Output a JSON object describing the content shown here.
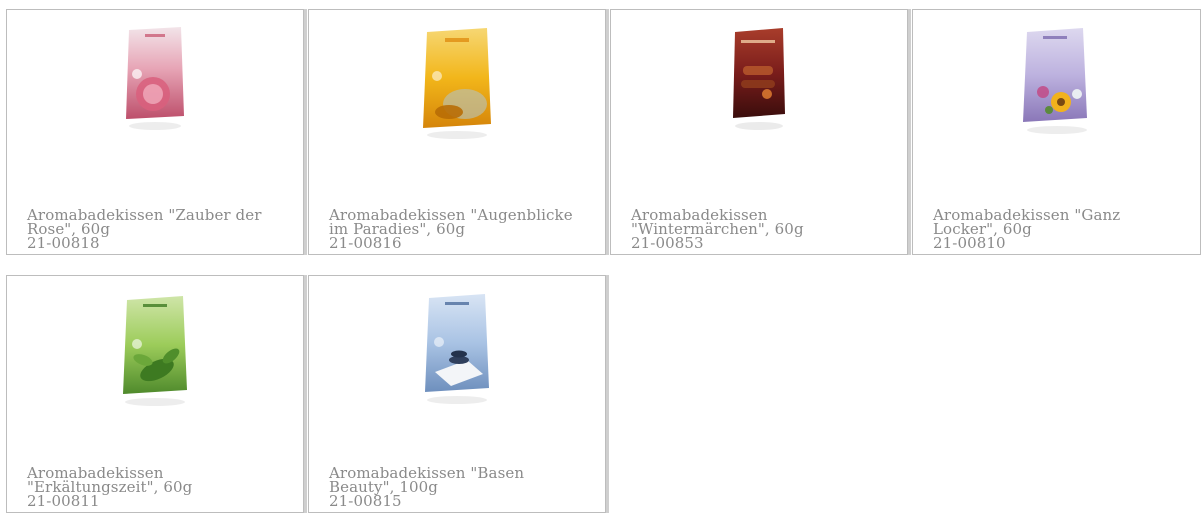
{
  "products": [
    {
      "title": "Aromabadekissen \"Zauber der Rose\", 60g",
      "sku": "21-00818",
      "image_icon": "rose-bath-sachet-icon",
      "colors": {
        "top": "#f2e4e9",
        "mid": "#e7a5b6",
        "bottom": "#bd4f6b"
      }
    },
    {
      "title": "Aromabadekissen \"Augenblicke im Paradies\", 60g",
      "sku": "21-00816",
      "image_icon": "paradise-bath-sachet-icon",
      "colors": {
        "top": "#f6d773",
        "mid": "#f2b61a",
        "bottom": "#d5850a"
      }
    },
    {
      "title": "Aromabadekissen \"Wintermärchen\", 60g",
      "sku": "21-00853",
      "image_icon": "winter-tale-bath-sachet-icon",
      "colors": {
        "top": "#a93d2b",
        "mid": "#7a1d1b",
        "bottom": "#3a0d0c"
      }
    },
    {
      "title": "Aromabadekissen \"Ganz Locker\", 60g",
      "sku": "21-00810",
      "image_icon": "relax-bath-sachet-icon",
      "colors": {
        "top": "#ddd8ef",
        "mid": "#bdb2df",
        "bottom": "#8a77b8"
      }
    },
    {
      "title": "Aromabadekissen \"Erkältungszeit\", 60g",
      "sku": "21-00811",
      "image_icon": "cold-season-bath-sachet-icon",
      "colors": {
        "top": "#cfe5a8",
        "mid": "#9ccc5a",
        "bottom": "#4f8a2c"
      }
    },
    {
      "title": "Aromabadekissen \"Basen Beauty\", 100g",
      "sku": "21-00815",
      "image_icon": "alkaline-beauty-bath-sachet-icon",
      "colors": {
        "top": "#d8e4f4",
        "mid": "#a9c3e4",
        "bottom": "#6e8fbd"
      }
    }
  ]
}
